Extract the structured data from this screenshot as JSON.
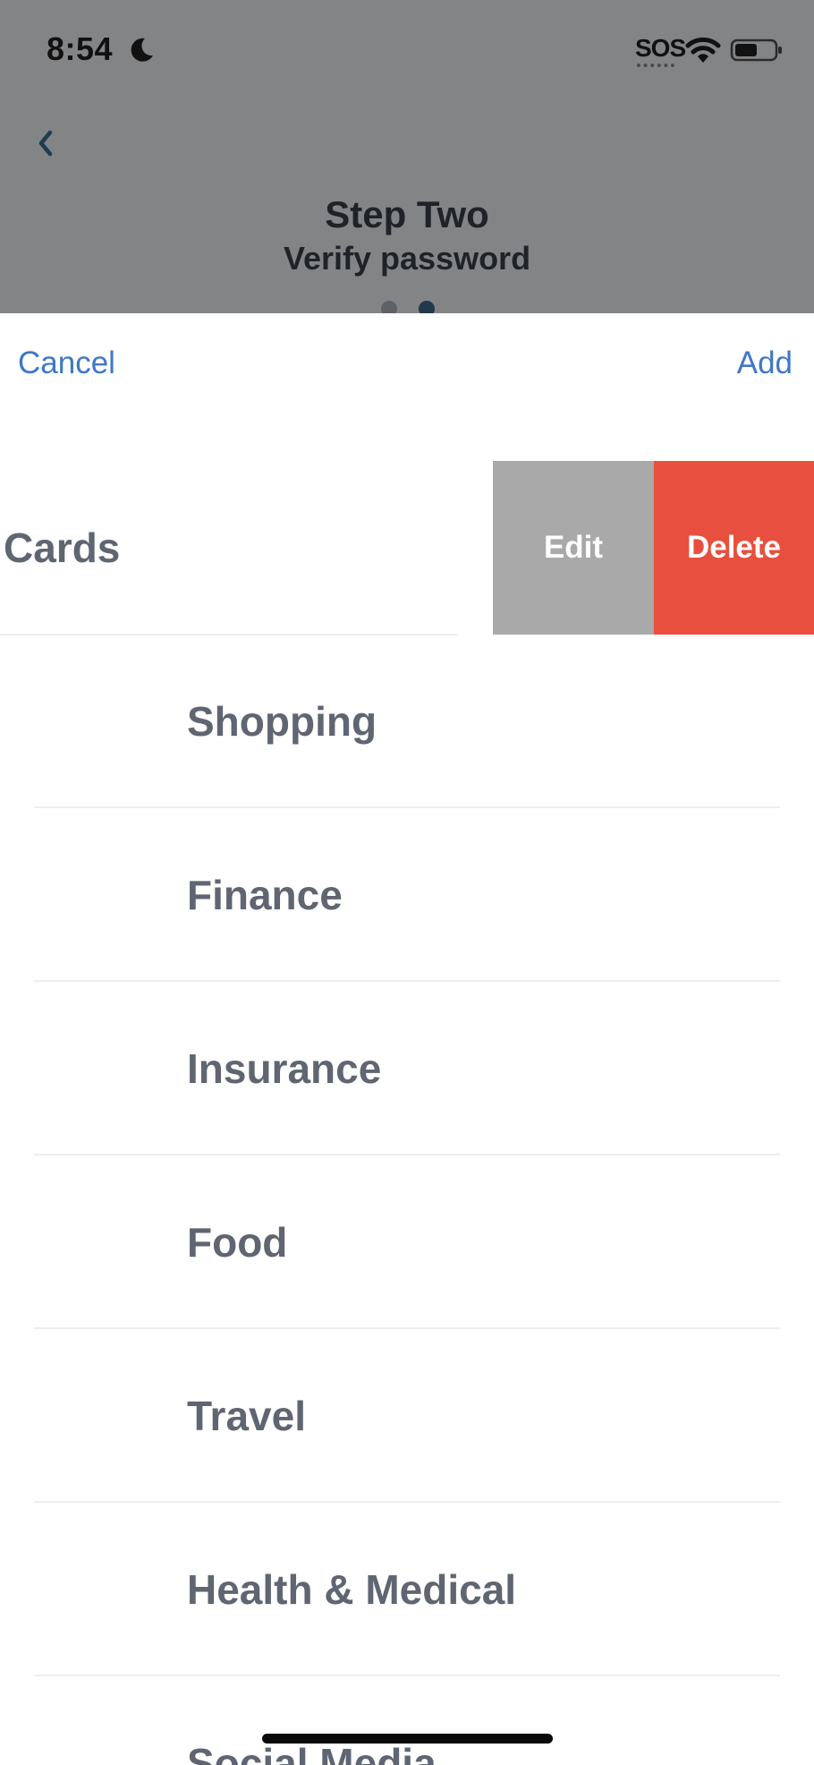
{
  "status_bar": {
    "time": "8:54",
    "sos": "SOS",
    "icons": [
      "moon-icon",
      "wifi-icon",
      "battery-icon"
    ]
  },
  "header": {
    "back_icon": "chevron-left-icon",
    "title": "Step Two",
    "subtitle": "Verify password",
    "page_indicator": {
      "pages": 2,
      "current": 2
    }
  },
  "sheet": {
    "cancel_label": "Cancel",
    "add_label": "Add",
    "swiped_row": {
      "label": "Cards",
      "edit_label": "Edit",
      "delete_label": "Delete"
    },
    "categories": [
      {
        "label": "Shopping"
      },
      {
        "label": "Finance"
      },
      {
        "label": "Insurance"
      },
      {
        "label": "Food"
      },
      {
        "label": "Travel"
      },
      {
        "label": "Health & Medical"
      },
      {
        "label": "Social Media"
      }
    ]
  },
  "colors": {
    "dim_overlay": "#838486",
    "link_blue": "#3f77c6",
    "edit_gray": "#a9a9a9",
    "delete_red": "#e94f3e",
    "label_gray": "#5f6672"
  }
}
